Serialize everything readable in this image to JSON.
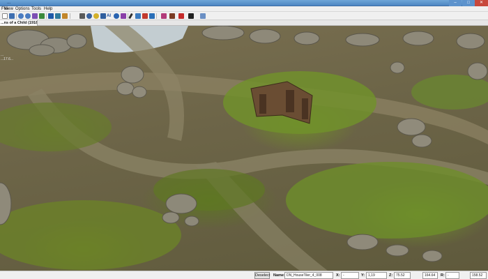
{
  "window": {
    "title": "..."
  },
  "menu": [
    "File",
    "View",
    "Options",
    "Tools",
    "Help"
  ],
  "toolbar": {
    "icons": [
      "new-file-icon",
      "save-icon",
      "undo-icon",
      "redo-icon",
      "paint-icon",
      "terrain-icon",
      "select-icon",
      "zone-icon",
      "layer-icon",
      "object-icon",
      "sound-icon",
      "ai-icon",
      "camera-icon",
      "grid-icon",
      "light-icon",
      "path-icon",
      "brush-icon",
      "fog-icon",
      "flag-icon",
      "shield-icon",
      "chest-icon",
      "region-icon",
      "person-icon",
      "settings-icon",
      "monster-icon",
      "marker-icon",
      "portal-icon",
      "trigger-icon",
      "dungeon-icon"
    ],
    "ai_label": "AI"
  },
  "document": {
    "tab_label": "...ns of a Child (1918x927)"
  },
  "hud": {
    "line1": "...",
    "line2": "...17.6..."
  },
  "status": {
    "deselect_label": "Deselect",
    "name_label": "Name:",
    "name_value": "DN_HouseTiler_4_008",
    "x_label": "X:",
    "x_value": "-",
    "y_label": "Y:",
    "y_value": "1,19",
    "z_label": "Z:",
    "z_value": "75.52",
    "extra_value": "164.64",
    "r_label": "R:",
    "r_value": "-",
    "v_value": "158.52"
  }
}
